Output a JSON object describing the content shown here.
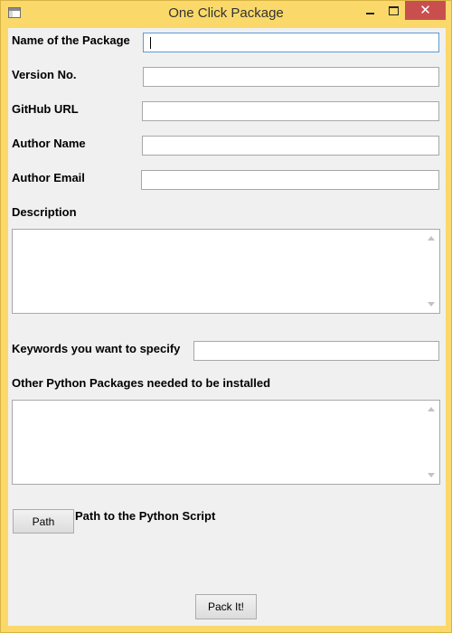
{
  "window": {
    "title": "One Click Package",
    "icon": "app-window-icon",
    "controls": {
      "minimize_icon": "minimize-icon",
      "maximize_icon": "maximize-icon",
      "close_glyph": "✕"
    }
  },
  "form": {
    "name": {
      "label": "Name of the Package",
      "value": ""
    },
    "version": {
      "label": "Version No.",
      "value": ""
    },
    "github": {
      "label": "GitHub URL",
      "value": ""
    },
    "author_name": {
      "label": "Author Name",
      "value": ""
    },
    "author_email": {
      "label": "Author Email",
      "value": ""
    },
    "description": {
      "label": "Description",
      "value": ""
    },
    "keywords": {
      "label": "Keywords you want to specify",
      "value": ""
    },
    "packages": {
      "label": "Other Python Packages needed to be installed",
      "value": ""
    },
    "path": {
      "button_label": "Path",
      "label": "Path to the Python Script"
    }
  },
  "actions": {
    "pack_label": "Pack It!"
  },
  "colors": {
    "titlebar": "#fad96a",
    "close_button": "#c94f4f",
    "client_background": "#f0f0f0",
    "focus_border": "#5b9bd5"
  }
}
